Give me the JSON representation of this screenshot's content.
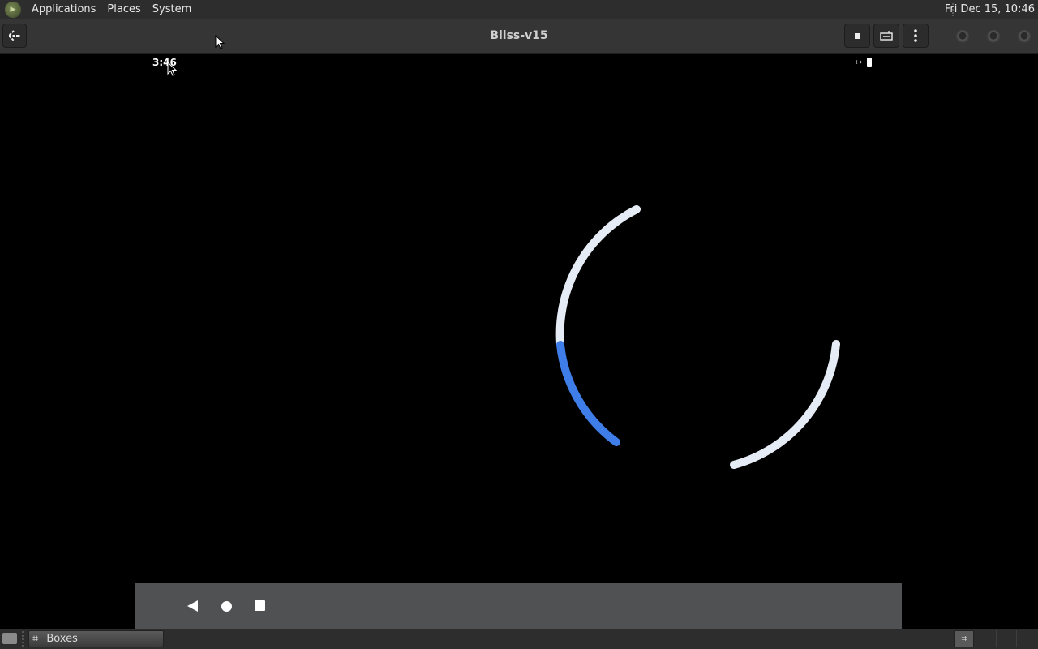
{
  "top_panel": {
    "menus": [
      "Applications",
      "Places",
      "System"
    ],
    "clock": "Fri Dec 15, 10:46"
  },
  "header": {
    "title": "Bliss-v15",
    "back_icon": "back-arrow-icon",
    "buttons": [
      "stop-icon",
      "keyboard-icon",
      "menu-kebab-icon"
    ]
  },
  "android": {
    "status_time": "3:46",
    "status_icons": [
      "vpn-arrows-icon",
      "battery-icon"
    ],
    "spinner": {
      "accent": "#3f7ee8",
      "track": "#e6ecf6"
    },
    "nav": [
      "back-icon",
      "home-icon",
      "recents-icon"
    ]
  },
  "taskbar": {
    "window_label": "Boxes"
  }
}
